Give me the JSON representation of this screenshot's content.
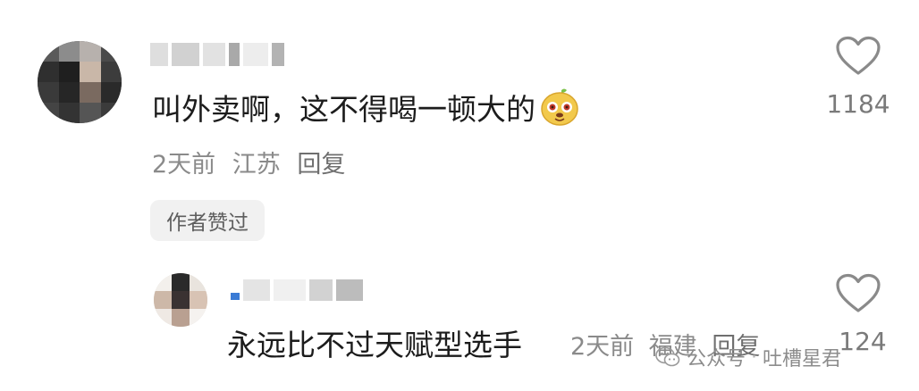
{
  "comments": [
    {
      "username": "小?",
      "text": "叫外卖啊，这不得喝一顿大的",
      "emoji_icon": "doge-emoji-icon",
      "time": "2天前",
      "location": "江苏",
      "reply_label": "回复",
      "author_badge": "作者赞过",
      "like_count": "1184",
      "like_icon": "heart-outline-icon"
    }
  ],
  "replies": [
    {
      "text": "永远比不过天赋型选手",
      "time": "2天前",
      "location": "福建",
      "reply_label": "回复",
      "like_count": "124",
      "like_icon": "heart-outline-icon"
    }
  ],
  "watermark": {
    "label": "公众号",
    "separator": "·",
    "account": "吐槽星君",
    "icon": "wechat-icon"
  },
  "colors": {
    "text_primary": "#1c1c1c",
    "text_secondary": "#8a8a8a",
    "badge_bg": "#f1f1f1",
    "heart_stroke": "#8a8a8a"
  }
}
